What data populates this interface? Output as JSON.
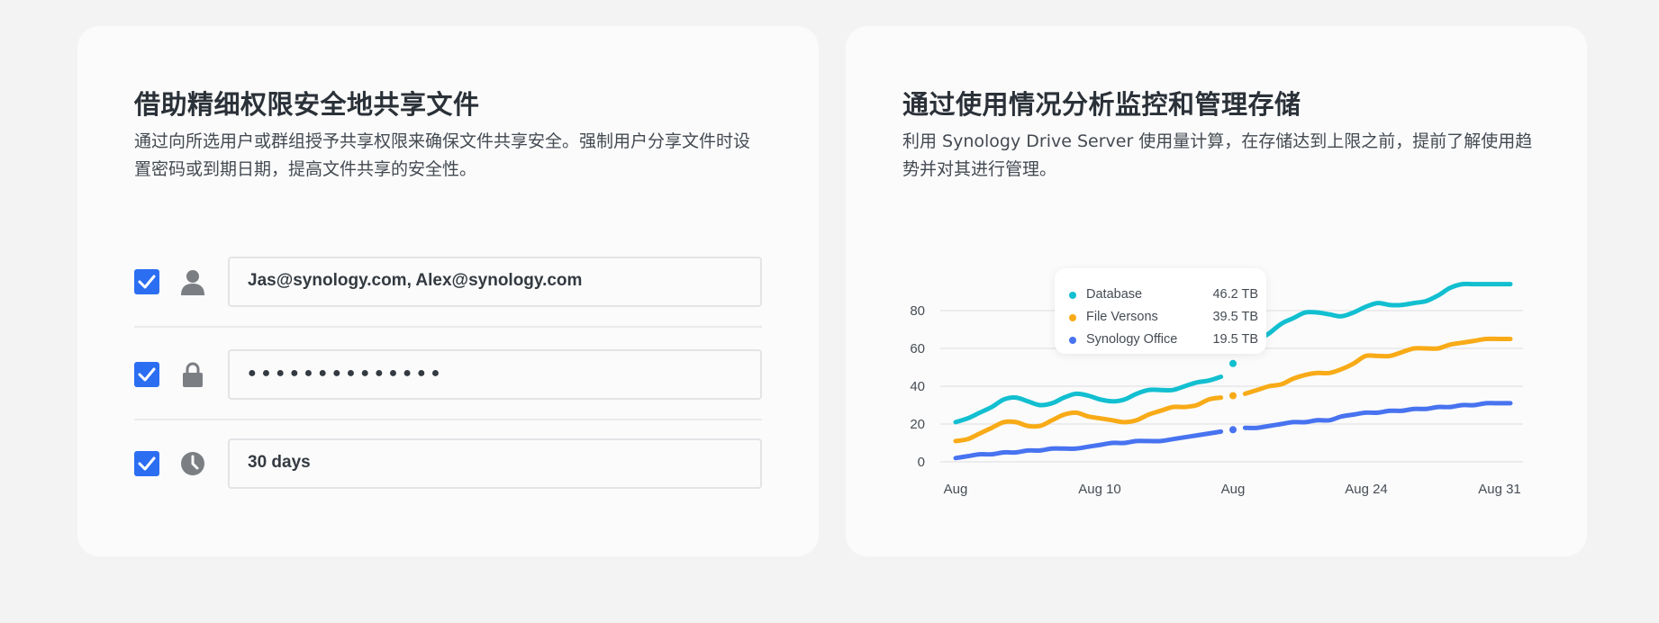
{
  "left_card": {
    "title": "借助精细权限安全地共享文件",
    "description": "通过向所选用户或群组授予共享权限来确保文件共享安全。强制用户分享文件时设置密码或到期日期，提高文件共享的安全性。",
    "rows": [
      {
        "icon": "user-icon",
        "value": "Jas@synology.com, Alex@synology.com",
        "checked": true
      },
      {
        "icon": "lock-icon",
        "value": "●●●●●●●●●●●●●●",
        "checked": true
      },
      {
        "icon": "clock-icon",
        "value": "30 days",
        "checked": true
      }
    ]
  },
  "right_card": {
    "title": "通过使用情况分析监控和管理存储",
    "description": "利用 Synology Drive Server 使用量计算，在存储达到上限之前，提前了解使用趋势并对其进行管理。"
  },
  "colors": {
    "accent": "#2c6ef2",
    "database": "#12bfd0",
    "file_versions": "#f8ab17",
    "synology_office": "#4873f0"
  },
  "chart_data": {
    "type": "line",
    "x": [
      0,
      1,
      2,
      3,
      4,
      5,
      6,
      7,
      8,
      9,
      10,
      11,
      12,
      13,
      14,
      15,
      16,
      17,
      18,
      19,
      20,
      21,
      22,
      23,
      24,
      25,
      26,
      27,
      28,
      29,
      30,
      31,
      32,
      33,
      34,
      35,
      36,
      37,
      38,
      39,
      40,
      41,
      42,
      43,
      44,
      45,
      46
    ],
    "x_tick_labels": [
      "Aug",
      "Aug 10",
      "Aug",
      "Aug 24",
      "Aug 31"
    ],
    "ylim": [
      0,
      95
    ],
    "y_ticks": [
      0,
      20,
      40,
      60,
      80
    ],
    "grid": true,
    "series": [
      {
        "name": "Database",
        "color": "#12bfd0",
        "tooltip_value": "46.2 TB",
        "values": [
          21,
          23,
          26,
          29,
          33,
          34,
          32,
          30,
          31,
          34,
          36,
          35,
          33,
          32,
          33,
          36,
          38,
          38,
          38,
          40,
          42,
          43,
          45,
          52,
          59,
          64,
          68,
          73,
          76,
          79,
          79,
          78,
          77,
          79,
          82,
          84,
          83,
          83,
          84,
          85,
          88,
          92,
          94,
          94,
          94,
          94,
          94
        ]
      },
      {
        "name": "File Versons",
        "color": "#f8ab17",
        "tooltip_value": "39.5 TB",
        "values": [
          11,
          12,
          15,
          18,
          21,
          21,
          19,
          19,
          22,
          25,
          26,
          24,
          23,
          22,
          21,
          22,
          25,
          27,
          29,
          29,
          30,
          33,
          34,
          35,
          36,
          38,
          40,
          41,
          44,
          46,
          47,
          47,
          49,
          52,
          56,
          56,
          56,
          58,
          60,
          60,
          60,
          62,
          63,
          64,
          65,
          65,
          65
        ]
      },
      {
        "name": "Synology Office",
        "color": "#4873f0",
        "tooltip_value": "19.5 TB",
        "values": [
          2,
          3,
          4,
          4,
          5,
          5,
          6,
          6,
          7,
          7,
          7,
          8,
          9,
          10,
          10,
          11,
          11,
          11,
          12,
          13,
          14,
          15,
          16,
          17,
          18,
          18,
          19,
          20,
          21,
          21,
          22,
          22,
          24,
          25,
          26,
          26,
          27,
          27,
          28,
          28,
          29,
          29,
          30,
          30,
          31,
          31,
          31
        ]
      }
    ]
  }
}
